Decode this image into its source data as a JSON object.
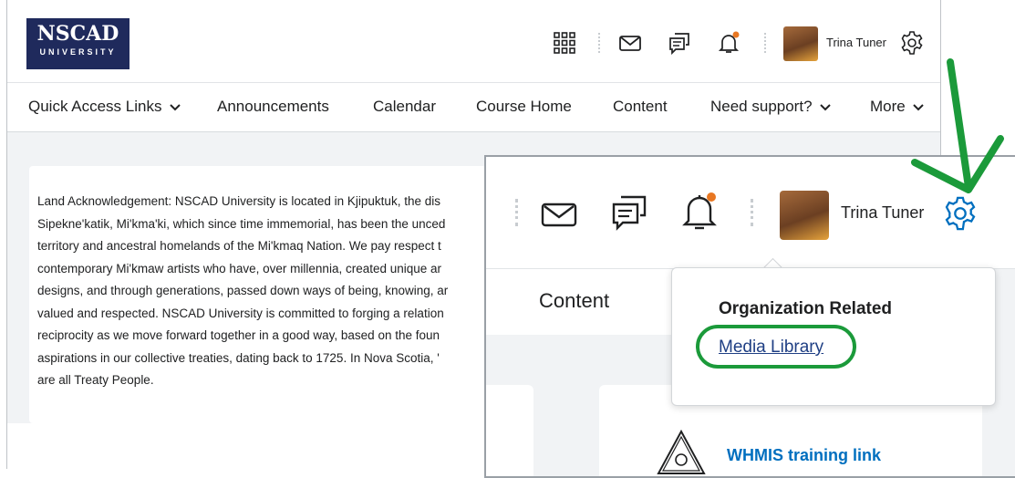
{
  "header": {
    "logo_line1": "NSCAD",
    "logo_line2": "UNIVERSITY",
    "user_name": "Trina Tuner"
  },
  "nav": {
    "items": [
      "Quick Access Links",
      "Announcements",
      "Calendar",
      "Course Home",
      "Content",
      "Need support?",
      "More"
    ]
  },
  "acknowledgement": {
    "lines": [
      "Land Acknowledgement: NSCAD University is located in Kjipuktuk, the dis",
      "Sipekne'katik, Mi'kma'ki, which since time immemorial, has been the unced",
      "territory and ancestral homelands of the Mi'kmaq Nation. We pay respect t",
      "contemporary Mi'kmaw artists who have, over millennia, created unique ar",
      "designs, and through generations, passed down ways of being, knowing, ar",
      "valued and respected. NSCAD University is committed to forging a relation",
      "reciprocity as we move forward together in a good way, based on the foun",
      "aspirations in our collective treaties, dating back to 1725.  In Nova Scotia, '",
      "are all Treaty People."
    ]
  },
  "zoom_inset": {
    "user_name": "Trina Tuner",
    "nav_label": "Content",
    "popup": {
      "heading": "Organization Related",
      "link": "Media Library"
    },
    "widget_link": "WHMIS training link"
  },
  "icons": [
    "waffle-icon",
    "mail-icon",
    "chat-icon",
    "bell-icon",
    "gear-icon",
    "chevron-down-icon",
    "hazard-icon"
  ],
  "colors": {
    "brand": "#1f2a5c",
    "accent_blue": "#006fbf",
    "highlight_green": "#1b9a3a",
    "notification": "#e87722"
  }
}
